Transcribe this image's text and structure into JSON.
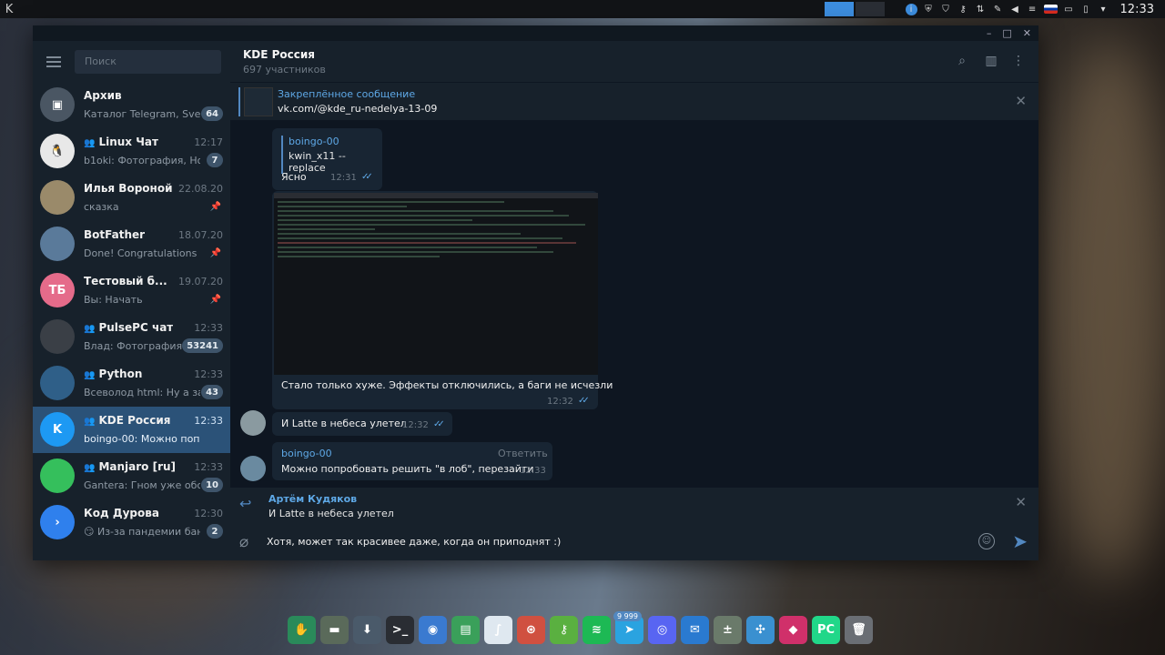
{
  "topbar": {
    "clock": "12:33",
    "kde_glyph": "K"
  },
  "window": {
    "title_buttons": [
      "–",
      "□",
      "✕"
    ]
  },
  "sidebar": {
    "search_placeholder": "Поиск",
    "chats": [
      {
        "name": "Архив",
        "time": "",
        "preview": "Каталог Telegram, Svel...",
        "badge": "64",
        "avatar_color": "#4a5663",
        "avatar_text": "▣",
        "group": false,
        "pinned": false
      },
      {
        "name": "Linux Чат",
        "time": "12:17",
        "preview": "b1oki: Фотография, Но ...",
        "badge": "7",
        "avatar_color": "#e8e8e8",
        "avatar_text": "🐧",
        "group": true,
        "pinned": false
      },
      {
        "name": "Илья Вороной",
        "time": "22.08.20",
        "preview": "сказка",
        "badge": "",
        "avatar_color": "#9a8a6a",
        "avatar_text": "",
        "group": false,
        "pinned": true
      },
      {
        "name": "BotFather",
        "time": "18.07.20",
        "preview": "Done! Congratulations o...",
        "badge": "",
        "avatar_color": "#5a7a9a",
        "avatar_text": "",
        "group": false,
        "pinned": true
      },
      {
        "name": "Тестовый б...",
        "time": "19.07.20",
        "preview": "Вы: Начать",
        "badge": "",
        "avatar_color": "#e56b8a",
        "avatar_text": "ТБ",
        "group": false,
        "pinned": true
      },
      {
        "name": "PulsePC чат",
        "time": "12:33",
        "preview": "Влад: Фотография",
        "badge": "53241",
        "avatar_color": "#3a3f46",
        "avatar_text": "",
        "group": true,
        "pinned": false
      },
      {
        "name": "Python",
        "time": "12:33",
        "preview": "Всеволод html: Ну а за...",
        "badge": "43",
        "avatar_color": "#2f5f88",
        "avatar_text": "",
        "group": true,
        "pinned": false
      },
      {
        "name": "KDE Россия",
        "time": "12:33",
        "preview": "boingo-00: Можно попробо...",
        "badge": "",
        "avatar_color": "#1d99f3",
        "avatar_text": "K",
        "group": true,
        "pinned": false
      },
      {
        "name": "Manjaro [ru]",
        "time": "12:33",
        "preview": "Gantera: Гном уже обсу...",
        "badge": "10",
        "avatar_color": "#35bf5c",
        "avatar_text": "",
        "group": true,
        "pinned": false
      },
      {
        "name": "Код Дурова",
        "time": "12:30",
        "preview": "😏 Из-за пандемии бан...",
        "badge": "2",
        "avatar_color": "#2f80ed",
        "avatar_text": "›",
        "group": false,
        "pinned": false
      }
    ]
  },
  "chat": {
    "title": "KDE Россия",
    "subtitle": "697 участников",
    "pinned_title": "Закреплённое сообщение",
    "pinned_text": "vk.com/@kde_ru-nedelya-13-09",
    "messages": [
      {
        "reply_name": "boingo-00",
        "reply_text": "kwin_x11 --replace",
        "text": "Ясно",
        "time": "12:31"
      },
      {
        "text": "Стало только хуже. Эффекты отключились, а баги не исчезли",
        "time": "12:32"
      },
      {
        "text": "И Latte в небеса улетел",
        "time": "12:32"
      },
      {
        "author": "boingo-00",
        "reply_link": "Ответить",
        "text": "Можно попробовать решить \"в лоб\", перезайти",
        "time": "12:33"
      }
    ]
  },
  "composer": {
    "reply_name": "Артём Кудяков",
    "reply_text": "И Latte в небеса улетел",
    "input_value": "Хотя, может так красивее даже, когда он приподнят :)"
  },
  "dock": {
    "telegram_badge": "9 999",
    "apps": [
      {
        "name": "kde-connect-icon",
        "color": "#2a8a5a",
        "glyph": "✋"
      },
      {
        "name": "notes-icon",
        "color": "#5a6a5a",
        "glyph": "▬"
      },
      {
        "name": "downloader-icon",
        "color": "#4a5a6a",
        "glyph": "⬇"
      },
      {
        "name": "terminal-icon",
        "color": "#2a2d33",
        "glyph": ">_"
      },
      {
        "name": "chromium-icon",
        "color": "#3a7ad0",
        "glyph": "◉"
      },
      {
        "name": "files-icon",
        "color": "#3aa05a",
        "glyph": "▤"
      },
      {
        "name": "writer-icon",
        "color": "#dfe8f0",
        "glyph": "∫"
      },
      {
        "name": "smartgit-icon",
        "color": "#d05040",
        "glyph": "⊛"
      },
      {
        "name": "keepass-icon",
        "color": "#5ab040",
        "glyph": "⚷"
      },
      {
        "name": "spotify-icon",
        "color": "#1db954",
        "glyph": "≋"
      },
      {
        "name": "telegram-icon",
        "color": "#2aa3e0",
        "glyph": "➤"
      },
      {
        "name": "discord-icon",
        "color": "#5865f2",
        "glyph": "◎"
      },
      {
        "name": "thunderbird-icon",
        "color": "#2a7ad0",
        "glyph": "✉"
      },
      {
        "name": "calculator-icon",
        "color": "#6a7a6a",
        "glyph": "±"
      },
      {
        "name": "kdevelop-icon",
        "color": "#3a90d0",
        "glyph": "✣"
      },
      {
        "name": "jetbrains-icon",
        "color": "#d0306a",
        "glyph": "◆"
      },
      {
        "name": "pycharm-icon",
        "color": "#21d789",
        "glyph": "PC"
      },
      {
        "name": "trash-icon",
        "color": "#6a6e74",
        "glyph": "🗑"
      }
    ]
  }
}
